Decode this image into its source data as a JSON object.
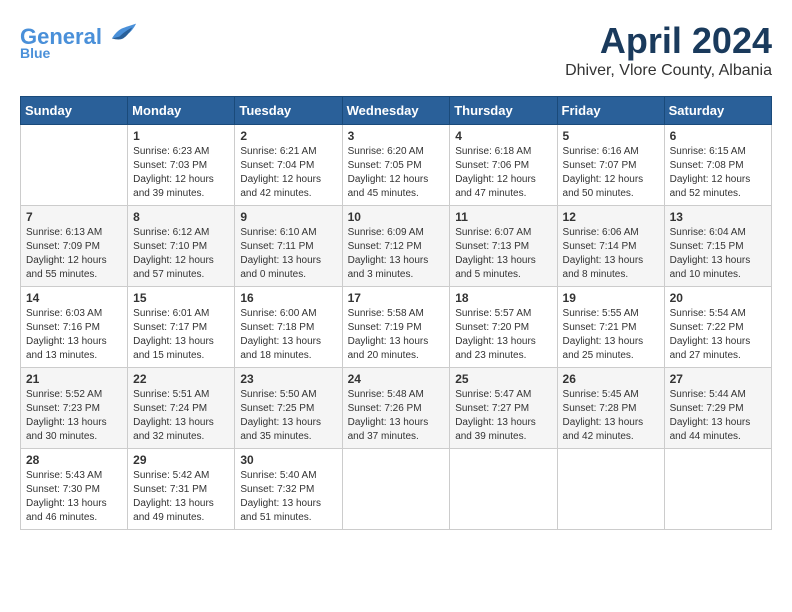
{
  "header": {
    "logo_line1": "General",
    "logo_line2": "Blue",
    "title": "April 2024",
    "subtitle": "Dhiver, Vlore County, Albania"
  },
  "calendar": {
    "headers": [
      "Sunday",
      "Monday",
      "Tuesday",
      "Wednesday",
      "Thursday",
      "Friday",
      "Saturday"
    ],
    "weeks": [
      [
        {
          "day": "",
          "content": ""
        },
        {
          "day": "1",
          "content": "Sunrise: 6:23 AM\nSunset: 7:03 PM\nDaylight: 12 hours\nand 39 minutes."
        },
        {
          "day": "2",
          "content": "Sunrise: 6:21 AM\nSunset: 7:04 PM\nDaylight: 12 hours\nand 42 minutes."
        },
        {
          "day": "3",
          "content": "Sunrise: 6:20 AM\nSunset: 7:05 PM\nDaylight: 12 hours\nand 45 minutes."
        },
        {
          "day": "4",
          "content": "Sunrise: 6:18 AM\nSunset: 7:06 PM\nDaylight: 12 hours\nand 47 minutes."
        },
        {
          "day": "5",
          "content": "Sunrise: 6:16 AM\nSunset: 7:07 PM\nDaylight: 12 hours\nand 50 minutes."
        },
        {
          "day": "6",
          "content": "Sunrise: 6:15 AM\nSunset: 7:08 PM\nDaylight: 12 hours\nand 52 minutes."
        }
      ],
      [
        {
          "day": "7",
          "content": "Sunrise: 6:13 AM\nSunset: 7:09 PM\nDaylight: 12 hours\nand 55 minutes."
        },
        {
          "day": "8",
          "content": "Sunrise: 6:12 AM\nSunset: 7:10 PM\nDaylight: 12 hours\nand 57 minutes."
        },
        {
          "day": "9",
          "content": "Sunrise: 6:10 AM\nSunset: 7:11 PM\nDaylight: 13 hours\nand 0 minutes."
        },
        {
          "day": "10",
          "content": "Sunrise: 6:09 AM\nSunset: 7:12 PM\nDaylight: 13 hours\nand 3 minutes."
        },
        {
          "day": "11",
          "content": "Sunrise: 6:07 AM\nSunset: 7:13 PM\nDaylight: 13 hours\nand 5 minutes."
        },
        {
          "day": "12",
          "content": "Sunrise: 6:06 AM\nSunset: 7:14 PM\nDaylight: 13 hours\nand 8 minutes."
        },
        {
          "day": "13",
          "content": "Sunrise: 6:04 AM\nSunset: 7:15 PM\nDaylight: 13 hours\nand 10 minutes."
        }
      ],
      [
        {
          "day": "14",
          "content": "Sunrise: 6:03 AM\nSunset: 7:16 PM\nDaylight: 13 hours\nand 13 minutes."
        },
        {
          "day": "15",
          "content": "Sunrise: 6:01 AM\nSunset: 7:17 PM\nDaylight: 13 hours\nand 15 minutes."
        },
        {
          "day": "16",
          "content": "Sunrise: 6:00 AM\nSunset: 7:18 PM\nDaylight: 13 hours\nand 18 minutes."
        },
        {
          "day": "17",
          "content": "Sunrise: 5:58 AM\nSunset: 7:19 PM\nDaylight: 13 hours\nand 20 minutes."
        },
        {
          "day": "18",
          "content": "Sunrise: 5:57 AM\nSunset: 7:20 PM\nDaylight: 13 hours\nand 23 minutes."
        },
        {
          "day": "19",
          "content": "Sunrise: 5:55 AM\nSunset: 7:21 PM\nDaylight: 13 hours\nand 25 minutes."
        },
        {
          "day": "20",
          "content": "Sunrise: 5:54 AM\nSunset: 7:22 PM\nDaylight: 13 hours\nand 27 minutes."
        }
      ],
      [
        {
          "day": "21",
          "content": "Sunrise: 5:52 AM\nSunset: 7:23 PM\nDaylight: 13 hours\nand 30 minutes."
        },
        {
          "day": "22",
          "content": "Sunrise: 5:51 AM\nSunset: 7:24 PM\nDaylight: 13 hours\nand 32 minutes."
        },
        {
          "day": "23",
          "content": "Sunrise: 5:50 AM\nSunset: 7:25 PM\nDaylight: 13 hours\nand 35 minutes."
        },
        {
          "day": "24",
          "content": "Sunrise: 5:48 AM\nSunset: 7:26 PM\nDaylight: 13 hours\nand 37 minutes."
        },
        {
          "day": "25",
          "content": "Sunrise: 5:47 AM\nSunset: 7:27 PM\nDaylight: 13 hours\nand 39 minutes."
        },
        {
          "day": "26",
          "content": "Sunrise: 5:45 AM\nSunset: 7:28 PM\nDaylight: 13 hours\nand 42 minutes."
        },
        {
          "day": "27",
          "content": "Sunrise: 5:44 AM\nSunset: 7:29 PM\nDaylight: 13 hours\nand 44 minutes."
        }
      ],
      [
        {
          "day": "28",
          "content": "Sunrise: 5:43 AM\nSunset: 7:30 PM\nDaylight: 13 hours\nand 46 minutes."
        },
        {
          "day": "29",
          "content": "Sunrise: 5:42 AM\nSunset: 7:31 PM\nDaylight: 13 hours\nand 49 minutes."
        },
        {
          "day": "30",
          "content": "Sunrise: 5:40 AM\nSunset: 7:32 PM\nDaylight: 13 hours\nand 51 minutes."
        },
        {
          "day": "",
          "content": ""
        },
        {
          "day": "",
          "content": ""
        },
        {
          "day": "",
          "content": ""
        },
        {
          "day": "",
          "content": ""
        }
      ]
    ]
  }
}
